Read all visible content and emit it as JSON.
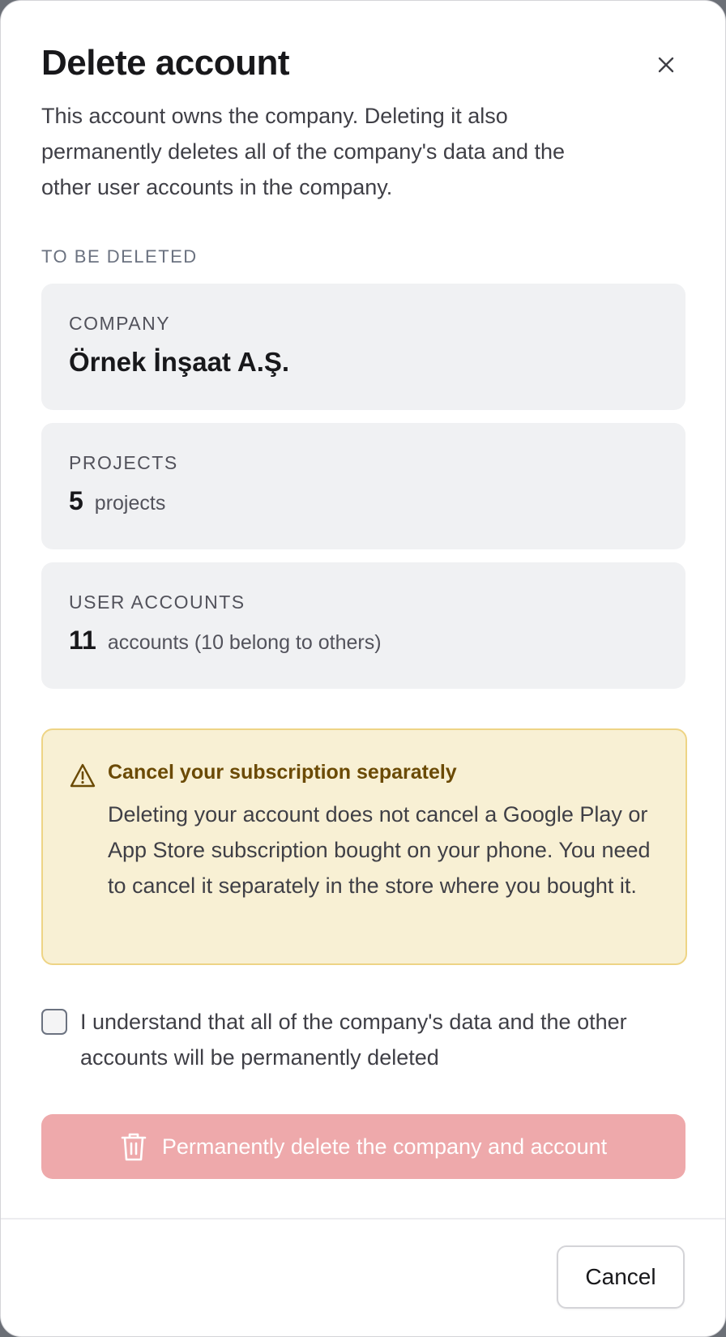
{
  "dialog": {
    "title": "Delete account",
    "close_icon": "close-icon",
    "description": "This account owns the company. Deleting it also permanently deletes all of the company's data and the other user accounts in the company."
  },
  "to_be_deleted": {
    "section_label": "TO BE DELETED",
    "company": {
      "label": "COMPANY",
      "value": "Örnek İnşaat A.Ş."
    },
    "projects": {
      "label": "PROJECTS",
      "count": "5",
      "unit": "projects"
    },
    "user_accounts": {
      "label": "USER ACCOUNTS",
      "count": "11",
      "unit": "accounts (10 belong to others)"
    }
  },
  "warning": {
    "icon": "warning-triangle-icon",
    "title": "Cancel your subscription separately",
    "text": "Deleting your account does not cancel a Google Play or App Store subscription bought on your phone. You need to cancel it separately in the store where you bought it."
  },
  "confirmation": {
    "checked": false,
    "label": "I understand that all of the company's data and the other accounts will be permanently deleted"
  },
  "actions": {
    "delete_icon": "trash-icon",
    "delete_label": "Permanently delete the company and account",
    "delete_enabled": false,
    "cancel_label": "Cancel"
  },
  "colors": {
    "delete_button_bg": "#eea9ab",
    "warning_bg": "#f8f0d4",
    "warning_border": "#eed485",
    "warning_title": "#6b4a05",
    "card_bg": "#f0f1f3"
  }
}
